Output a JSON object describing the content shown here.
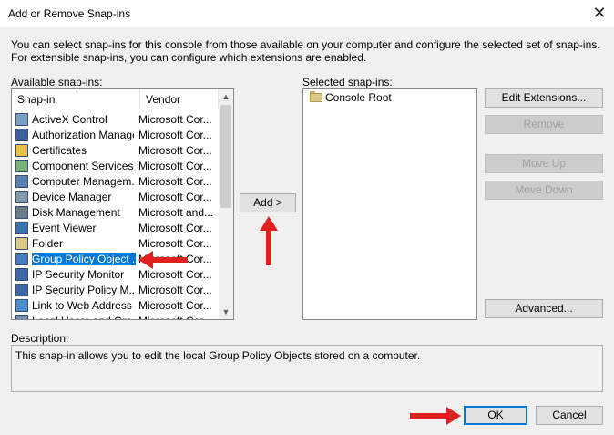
{
  "window": {
    "title": "Add or Remove Snap-ins"
  },
  "intro": "You can select snap-ins for this console from those available on your computer and configure the selected set of snap-ins. For extensible snap-ins, you can configure which extensions are enabled.",
  "available": {
    "label": "Available snap-ins:",
    "columns": {
      "snapin": "Snap-in",
      "vendor": "Vendor"
    },
    "rows": [
      {
        "name": "ActiveX Control",
        "vendor": "Microsoft Cor...",
        "icon": "activex-icon"
      },
      {
        "name": "Authorization Manager",
        "vendor": "Microsoft Cor...",
        "icon": "authorization-icon"
      },
      {
        "name": "Certificates",
        "vendor": "Microsoft Cor...",
        "icon": "certificate-icon"
      },
      {
        "name": "Component Services",
        "vendor": "Microsoft Cor...",
        "icon": "component-icon"
      },
      {
        "name": "Computer Managem...",
        "vendor": "Microsoft Cor...",
        "icon": "computer-icon"
      },
      {
        "name": "Device Manager",
        "vendor": "Microsoft Cor...",
        "icon": "device-icon"
      },
      {
        "name": "Disk Management",
        "vendor": "Microsoft and...",
        "icon": "disk-icon"
      },
      {
        "name": "Event Viewer",
        "vendor": "Microsoft Cor...",
        "icon": "event-icon"
      },
      {
        "name": "Folder",
        "vendor": "Microsoft Cor...",
        "icon": "folder-icon"
      },
      {
        "name": "Group Policy Object ...",
        "vendor": "Microsoft Cor...",
        "icon": "policy-icon"
      },
      {
        "name": "IP Security Monitor",
        "vendor": "Microsoft Cor...",
        "icon": "security-icon"
      },
      {
        "name": "IP Security Policy M...",
        "vendor": "Microsoft Cor...",
        "icon": "security-icon"
      },
      {
        "name": "Link to Web Address",
        "vendor": "Microsoft Cor...",
        "icon": "link-icon"
      },
      {
        "name": "Local Users and Gro...",
        "vendor": "Microsoft Cor...",
        "icon": "users-icon"
      }
    ]
  },
  "selected": {
    "label": "Selected snap-ins:",
    "items": [
      {
        "name": "Console Root",
        "icon": "folder-icon"
      }
    ]
  },
  "buttons": {
    "add": "Add >",
    "edit_extensions": "Edit Extensions...",
    "remove": "Remove",
    "move_up": "Move Up",
    "move_down": "Move Down",
    "advanced": "Advanced...",
    "ok": "OK",
    "cancel": "Cancel"
  },
  "description": {
    "label": "Description:",
    "text": "This snap-in allows you to edit the local Group Policy Objects stored on a computer."
  },
  "colors": {
    "accent": "#0078d7",
    "annotation": "#e0201e"
  }
}
